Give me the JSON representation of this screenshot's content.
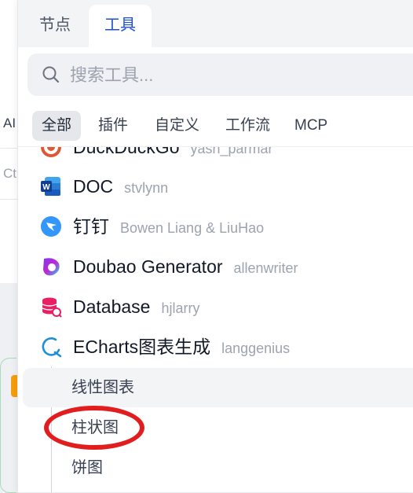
{
  "background": {
    "fragment_1": "AI",
    "fragment_2": "Ct"
  },
  "panel": {
    "tabs": [
      {
        "label": "节点"
      },
      {
        "label": "工具",
        "active": true
      }
    ],
    "search": {
      "placeholder": "搜索工具...",
      "value": "",
      "icon": "search-icon"
    },
    "filters": [
      {
        "label": "全部",
        "active": true
      },
      {
        "label": "插件"
      },
      {
        "label": "自定义"
      },
      {
        "label": "工作流"
      },
      {
        "label": "MCP"
      }
    ],
    "tools": [
      {
        "name": "DuckDuckGo",
        "author": "yash_parmar",
        "icon": "duckduckgo-icon",
        "color": "#de5833"
      },
      {
        "name": "DOC",
        "author": "stvlynn",
        "icon": "word-doc-icon",
        "color": "#185abd"
      },
      {
        "name": "钉钉",
        "author": "Bowen Liang & LiuHao",
        "icon": "dingtalk-icon",
        "color": "#3296fa"
      },
      {
        "name": "Doubao Generator",
        "author": "allenwriter",
        "icon": "doubao-icon",
        "color": "#7c3aed"
      },
      {
        "name": "Database",
        "author": "hjlarry",
        "icon": "database-icon",
        "color": "#e91e63"
      },
      {
        "name": "ECharts图表生成",
        "author": "langgenius",
        "icon": "echarts-icon",
        "color": "#1e90d6"
      }
    ],
    "echarts_actions": [
      {
        "label": "线性图表",
        "hovered": true
      },
      {
        "label": "柱状图",
        "highlighted": true
      },
      {
        "label": "饼图"
      }
    ]
  },
  "annotation_color": "#e11d1d"
}
